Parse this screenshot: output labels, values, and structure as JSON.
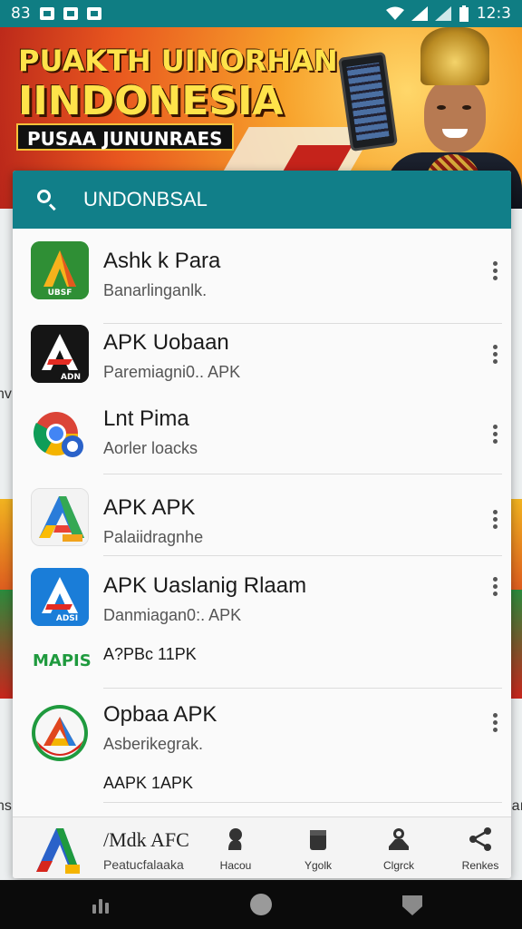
{
  "status_bar": {
    "left_text": "83",
    "time": "12:3"
  },
  "banner": {
    "line1": "PUAKTH UINORHAN",
    "line2": "IINDONESIA",
    "tagline": "PUSAA JUNUNRAES"
  },
  "search": {
    "value": "UNDONBSAL"
  },
  "apps": [
    {
      "title": "Ashk k Para",
      "subtitle": "Banarlinganlk.",
      "icon_label": "UBSF",
      "icon": "green-a-icon"
    },
    {
      "title": "APK Uobaan",
      "subtitle": "Paremiagni0.. APK",
      "icon_label": "ADN",
      "icon": "dark-a-icon"
    },
    {
      "title": "Lnt Pima",
      "subtitle": "Aorler loacks",
      "icon": "chrome-icon"
    },
    {
      "title": "APK APK",
      "subtitle": "Palaiidragnhe",
      "icon": "multicolor-a-icon"
    },
    {
      "title": "APK Uaslanig Rlaam",
      "subtitle": "Danmiagan0:. APK",
      "icon_label": "ADSI",
      "icon": "blue-a-icon",
      "extra_badge": "MAPIS",
      "extra_text": "A?PBc  11PK"
    },
    {
      "title": "Opbaa APK",
      "subtitle": "Asberikegrak.",
      "icon": "round-a-icon",
      "extra_text": "AAPK  1APK"
    }
  ],
  "bottom_nav": {
    "primary_title": "/Mdk AFC",
    "primary_sub": "Peatucfalaaka",
    "items": [
      {
        "label": "Hacou",
        "icon": "person-icon"
      },
      {
        "label": "Ygolk",
        "icon": "box-icon"
      },
      {
        "label": "Clgrck",
        "icon": "user-card-icon"
      },
      {
        "label": "Renkes",
        "icon": "share-icon"
      }
    ]
  },
  "colors": {
    "primary": "#117f89",
    "status_bar": "#0f7d83"
  }
}
